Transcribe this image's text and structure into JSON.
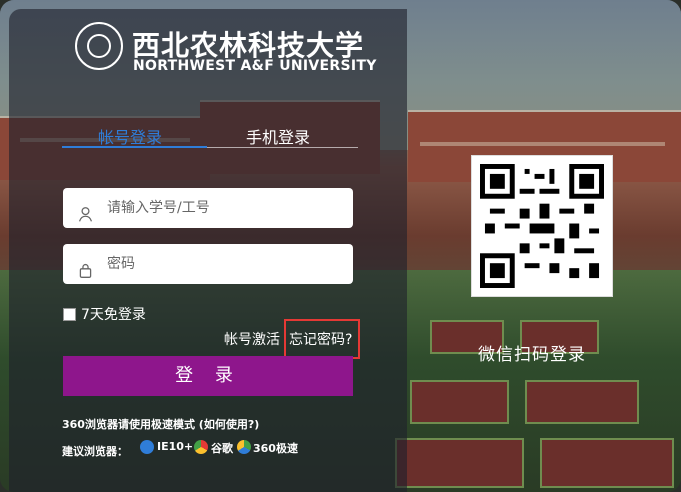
{
  "university": {
    "name_cn": "西北农林科技大学",
    "name_en": "NORTHWEST A&F UNIVERSITY"
  },
  "tabs": [
    {
      "label": "帐号登录",
      "active": true
    },
    {
      "label": "手机登录",
      "active": false
    }
  ],
  "form": {
    "username_placeholder": "请输入学号/工号",
    "password_placeholder": "密码",
    "remember_label": "7天免登录",
    "activate_link": "帐号激活",
    "forgot_link": "忘记密码?",
    "login_button": "登 录"
  },
  "footer": {
    "note": "360浏览器请使用极速模式 (如何使用?)",
    "suggest_label": "建议浏览器：",
    "browsers": [
      "IE10+",
      "谷歌",
      "360极速"
    ]
  },
  "qr": {
    "label": "微信扫码登录"
  },
  "colors": {
    "accent": "#8e168c",
    "tab_active": "#2f7dd8",
    "highlight": "#e53935"
  },
  "icons": {
    "username": "user-icon",
    "password": "lock-icon"
  }
}
